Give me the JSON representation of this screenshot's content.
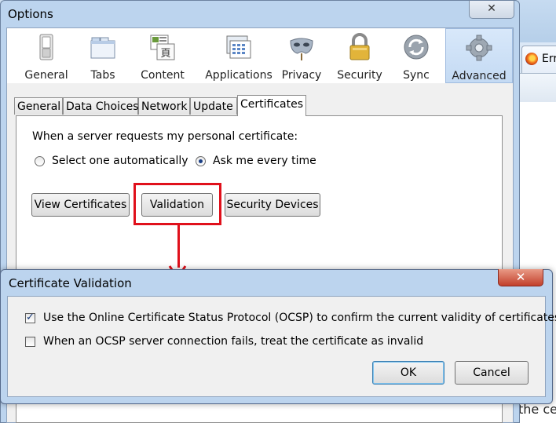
{
  "background_window": {
    "tab_title": "Err",
    "content_text": "the ce"
  },
  "options": {
    "title": "Options",
    "close_glyph": "✕",
    "toolbar": [
      {
        "label": "General",
        "icon": "switch-icon"
      },
      {
        "label": "Tabs",
        "icon": "tabs-icon"
      },
      {
        "label": "Content",
        "icon": "content-icon"
      },
      {
        "label": "Applications",
        "icon": "applications-icon"
      },
      {
        "label": "Privacy",
        "icon": "mask-icon"
      },
      {
        "label": "Security",
        "icon": "padlock-icon"
      },
      {
        "label": "Sync",
        "icon": "sync-icon"
      },
      {
        "label": "Advanced",
        "icon": "gear-icon",
        "selected": true
      }
    ],
    "subtabs": [
      {
        "label": "General"
      },
      {
        "label": "Data Choices"
      },
      {
        "label": "Network"
      },
      {
        "label": "Update"
      },
      {
        "label": "Certificates",
        "active": true
      }
    ],
    "cert_prompt": "When a server requests my personal certificate:",
    "radio_auto": "Select one automatically",
    "radio_ask": "Ask me every time",
    "selected_radio": "ask",
    "btn_view": "View Certificates",
    "btn_validation": "Validation",
    "btn_devices": "Security Devices"
  },
  "dialog": {
    "title": "Certificate Validation",
    "close_glyph": "✕",
    "ocsp_label": "Use the Online Certificate Status Protocol (OCSP) to confirm the current validity of certificates",
    "ocsp_checked": true,
    "fail_label": "When an OCSP server connection fails, treat the certificate as invalid",
    "fail_checked": false,
    "ok_label": "OK",
    "cancel_label": "Cancel"
  },
  "colors": {
    "highlight": "#e0101b",
    "window_frame": "#bcd4ee",
    "selected_tool": "#c4daf3"
  }
}
